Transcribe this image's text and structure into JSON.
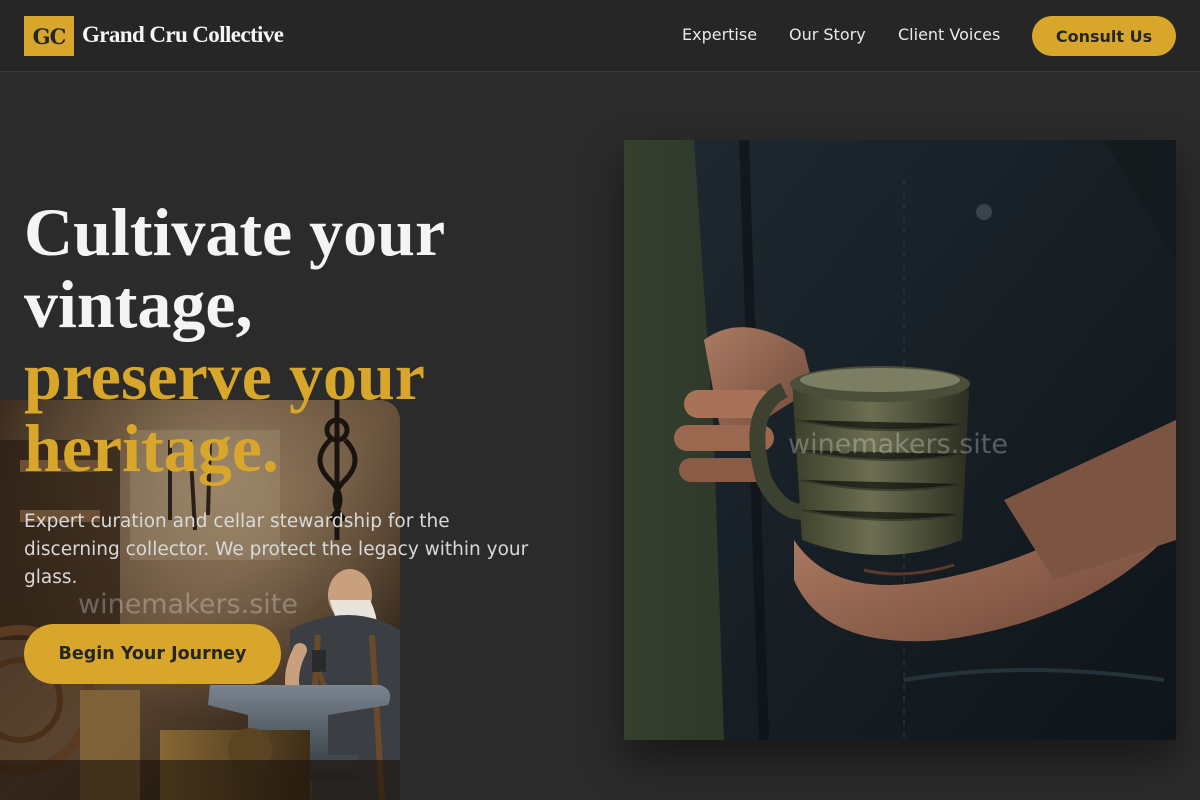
{
  "header": {
    "logo_mark": "GC",
    "brand_name": "Grand Cru Collective",
    "nav": [
      {
        "label": "Expertise"
      },
      {
        "label": "Our Story"
      },
      {
        "label": "Client Voices"
      }
    ],
    "cta_label": "Consult Us"
  },
  "hero": {
    "headline_line1": "Cultivate your",
    "headline_line2": "vintage,",
    "headline_line3": "preserve your",
    "headline_line4": "heritage.",
    "subtext": "Expert curation and cellar stewardship for the discerning collector. We protect the legacy within your glass.",
    "cta_label": "Begin Your Journey"
  },
  "images": {
    "hero_photo": "hands holding a ceramic mug in front of a dark apron",
    "workshop_photo": "blacksmith working at an anvil in a workshop"
  },
  "watermark": "winemakers.site",
  "colors": {
    "background": "#2b2b2b",
    "header_background": "#262626",
    "accent_gold": "#d8a62b",
    "text_primary": "#f4f4f4"
  }
}
